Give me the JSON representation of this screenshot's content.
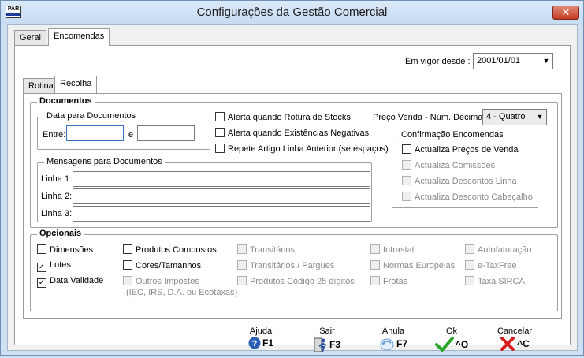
{
  "window": {
    "title": "Configurações da Gestão Comercial",
    "app_icon_text": "PAR",
    "close_label": "✕"
  },
  "tabs_outer": [
    {
      "label": "Geral",
      "active": false
    },
    {
      "label": "Encomendas",
      "active": true
    }
  ],
  "em_vigor": {
    "label": "Em vigor desde :",
    "value": "2001/01/01"
  },
  "tabs_inner": [
    {
      "label": "Rotina",
      "active": false
    },
    {
      "label": "Recolha",
      "active": true
    }
  ],
  "documentos": {
    "title": "Documentos",
    "data_group": {
      "title": "Data para Documentos",
      "entre_label": "Entre:",
      "e_label": "e",
      "entre_value": "",
      "e_value": ""
    },
    "alerts": [
      {
        "label": "Alerta quando Rotura de Stocks",
        "checked": false
      },
      {
        "label": "Alerta quando Existências Negativas",
        "checked": false
      },
      {
        "label": "Repete Artigo Linha Anterior (se espaços)",
        "checked": false
      }
    ],
    "preco_venda": {
      "label": "Preço Venda - Núm. Decimais",
      "value": "4 - Quatro"
    },
    "mensagens": {
      "title": "Mensagens para Documentos",
      "lines": [
        {
          "label": "Linha 1:",
          "value": ""
        },
        {
          "label": "Linha 2:",
          "value": ""
        },
        {
          "label": "Linha 3:",
          "value": ""
        }
      ]
    },
    "confirmacao": {
      "title": "Confirmação Encomendas",
      "items": [
        {
          "label": "Actualiza Preços de Venda",
          "checked": false,
          "enabled": true
        },
        {
          "label": "Actualiza Comissões",
          "checked": false,
          "enabled": false
        },
        {
          "label": "Actualiza Descontos Linha",
          "checked": false,
          "enabled": false
        },
        {
          "label": "Actualiza Desconto Cabeçalho",
          "checked": false,
          "enabled": false
        }
      ]
    }
  },
  "opcionais": {
    "title": "Opcionais",
    "items": [
      {
        "label": "Dimensões",
        "checked": false,
        "enabled": true
      },
      {
        "label": "Lotes",
        "checked": true,
        "enabled": true
      },
      {
        "label": "Data Validade",
        "checked": true,
        "enabled": true
      },
      {
        "label": "Produtos Compostos",
        "checked": false,
        "enabled": true
      },
      {
        "label": "Cores/Tamanhos",
        "checked": false,
        "enabled": true
      },
      {
        "label": "Outros Impostos",
        "checked": false,
        "enabled": false
      },
      {
        "label": "Transitários",
        "checked": false,
        "enabled": false
      },
      {
        "label": "Transitários / Pargues",
        "checked": false,
        "enabled": false
      },
      {
        "label": "Produtos Código 25 dígitos",
        "checked": false,
        "enabled": false
      },
      {
        "label": "Intrastat",
        "checked": false,
        "enabled": false
      },
      {
        "label": "Normas Europeias",
        "checked": false,
        "enabled": false
      },
      {
        "label": "Frotas",
        "checked": false,
        "enabled": false
      },
      {
        "label": "Autofaturação",
        "checked": false,
        "enabled": false
      },
      {
        "label": "e-TaxFree",
        "checked": false,
        "enabled": false
      },
      {
        "label": "Taxa SIRCA",
        "checked": false,
        "enabled": false
      }
    ],
    "outros_note": "(IEC, IRS, D.A. ou Ecotaxas)"
  },
  "buttons": [
    {
      "caption": "Ajuda",
      "key": "F1",
      "icon": "help-icon",
      "color": "#2a5fb5"
    },
    {
      "caption": "Sair",
      "key": "F3",
      "icon": "exit-door-icon",
      "color": "#2a4f9a"
    },
    {
      "caption": "Anula",
      "key": "F7",
      "icon": "undo-icon",
      "color": "#6aa0d8"
    },
    {
      "caption": "Ok",
      "key": "^O",
      "icon": "checkmark-icon",
      "color": "#2aa52a"
    },
    {
      "caption": "Cancelar",
      "key": "^C",
      "icon": "x-cancel-icon",
      "color": "#d42020"
    }
  ]
}
